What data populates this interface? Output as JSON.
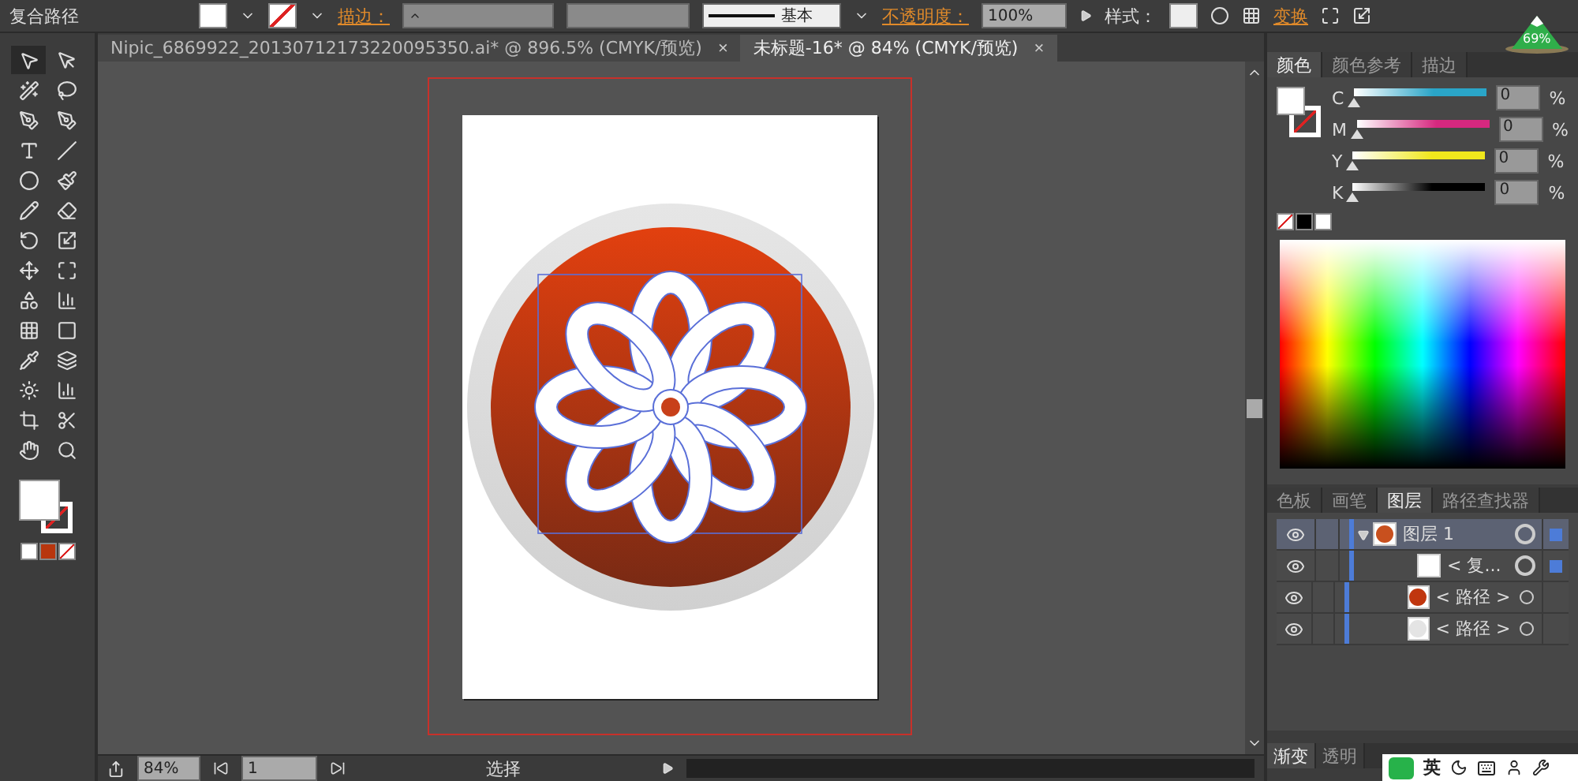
{
  "control_bar": {
    "object_type": "复合路径",
    "stroke_label": "描边：",
    "stroke_profile": "基本",
    "opacity_label": "不透明度：",
    "opacity_value": "100%",
    "style_label": "样式：",
    "transform_link": "变换"
  },
  "document_tabs": [
    {
      "title": "Nipic_6869922_20130712173220095350.ai* @ 896.5% (CMYK/预览)",
      "close": "×",
      "selected": false
    },
    {
      "title": "未标题-16* @ 84% (CMYK/预览)",
      "close": "×",
      "selected": true
    }
  ],
  "color_panel": {
    "tabs": [
      {
        "label": "颜色",
        "selected": true
      },
      {
        "label": "颜色参考",
        "selected": false
      },
      {
        "label": "描边",
        "selected": false
      }
    ],
    "channels": [
      {
        "name": "C",
        "value": "0",
        "unit": "%",
        "level": 0,
        "color": "#2aa5c8"
      },
      {
        "name": "M",
        "value": "0",
        "unit": "%",
        "level": 0,
        "color": "#d6287f"
      },
      {
        "name": "Y",
        "value": "0",
        "unit": "%",
        "level": 0,
        "color": "#f0e81c"
      },
      {
        "name": "K",
        "value": "0",
        "unit": "%",
        "level": 0,
        "color": "#000000"
      }
    ]
  },
  "layers_panel": {
    "tabs": [
      {
        "label": "色板",
        "selected": false
      },
      {
        "label": "画笔",
        "selected": false
      },
      {
        "label": "图层",
        "selected": true
      },
      {
        "label": "路径查找器",
        "selected": false
      }
    ],
    "layers": [
      {
        "name": "图层 1",
        "visible": true,
        "expanded": true,
        "selected": true,
        "color": "#c8501e",
        "children": [
          {
            "name": "< 复...",
            "visible": true,
            "targeted": true,
            "color": "#ffffff"
          },
          {
            "name": "< 路径 >",
            "visible": true,
            "targeted": false,
            "color": "#c0360e"
          },
          {
            "name": "< 路径 >",
            "visible": true,
            "targeted": false,
            "color": "#e4e4e4"
          }
        ]
      }
    ]
  },
  "bottom_tabs": [
    {
      "label": "渐变",
      "selected": true
    },
    {
      "label": "透明",
      "selected": false
    }
  ],
  "status_bar": {
    "zoom": "84%",
    "artboard": "1",
    "tool": "选择"
  },
  "widget": {
    "percent": "69%"
  },
  "ime_bar": {
    "language": "英"
  }
}
